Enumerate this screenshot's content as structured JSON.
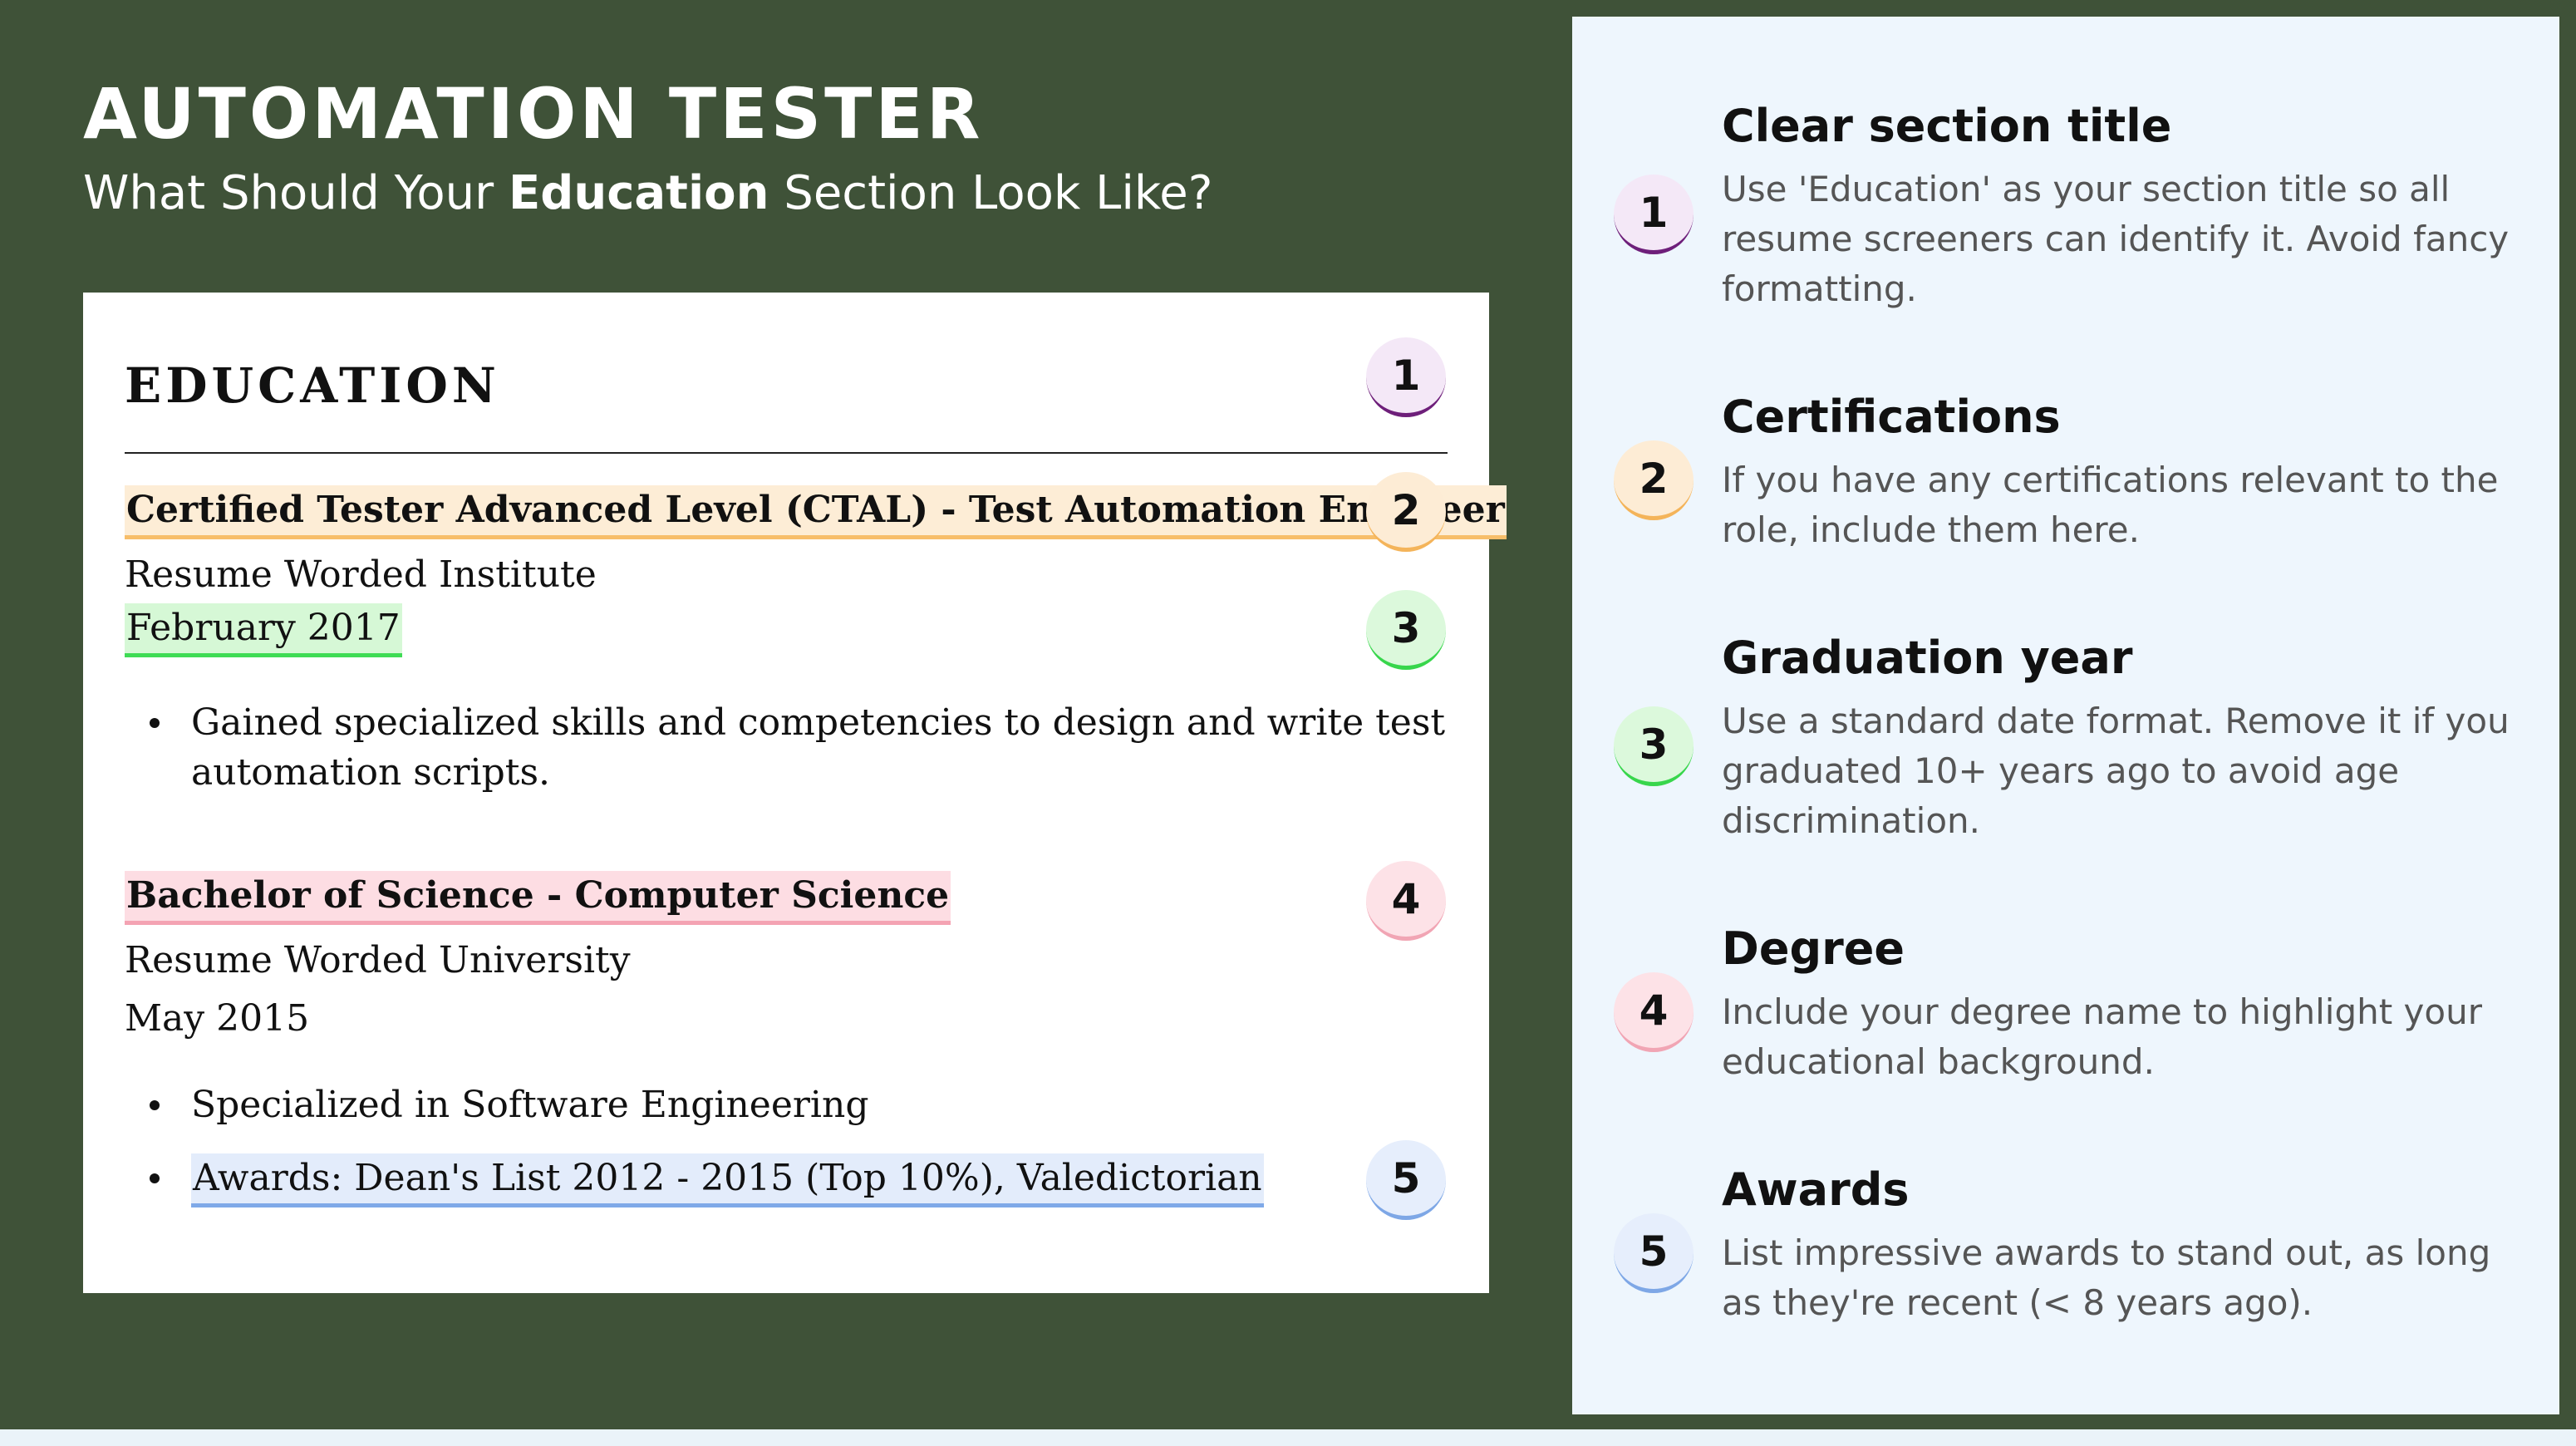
{
  "header": {
    "title": "AUTOMATION TESTER",
    "subtitle_before": "What Should Your ",
    "subtitle_bold": "Education",
    "subtitle_after": " Section Look Like?"
  },
  "resume": {
    "heading": "EDUCATION",
    "entries": [
      {
        "title": "Certified Tester Advanced Level (CTAL) - Test Automation Engineer",
        "institution": "Resume Worded Institute",
        "date": "February 2017",
        "bullets": [
          "Gained specialized skills and competencies to design and write test",
          "automation scripts."
        ]
      },
      {
        "title": "Bachelor of Science - Computer Science",
        "institution": "Resume Worded University",
        "date": "May 2015",
        "bullets": [
          "Specialized in Software Engineering",
          "Awards: Dean's List 2012 - 2015 (Top 10%), Valedictorian"
        ]
      }
    ]
  },
  "badges": [
    "1",
    "2",
    "3",
    "4",
    "5"
  ],
  "tips": [
    {
      "number": "1",
      "title": "Clear section title",
      "description": "Use 'Education' as your section title so all resume screeners can identify it. Avoid fancy formatting."
    },
    {
      "number": "2",
      "title": "Certifications",
      "description": "If you have any certifications relevant to the role, include them here."
    },
    {
      "number": "3",
      "title": "Graduation year",
      "description": "Use a standard date format. Remove it if you graduated 10+ years ago to avoid age discrimination."
    },
    {
      "number": "4",
      "title": "Degree",
      "description": "Include your degree name to highlight your educational background."
    },
    {
      "number": "5",
      "title": "Awards",
      "description": "List impressive awards to stand out, as long as they're recent (< 8 years ago)."
    }
  ],
  "colors": {
    "background": "#3f5238",
    "panel": "#eef6fd",
    "tip1": "#6e1f7a",
    "tip2": "#f4b45a",
    "tip3": "#38d64c",
    "tip4": "#f1a5b4",
    "tip5": "#7ea7e6"
  }
}
